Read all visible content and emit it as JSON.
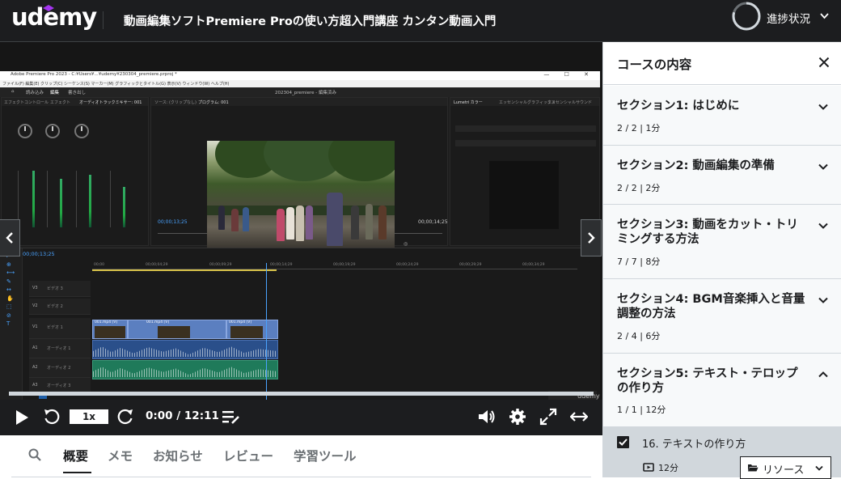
{
  "header": {
    "logo": "udemy",
    "course_title": "動画編集ソフトPremiere Proの使い方超入門講座 カンタン動画入門",
    "progress_label": "進捗状況"
  },
  "player": {
    "speed": "1x",
    "time": "0:00 / 12:11",
    "premiere": {
      "window_title": "Adobe Premiere Pro 2023 - C:¥Users¥...¥udemy¥230304_premiere.prproj *",
      "menu": "ファイル(F)  編集(E)  クリップ(C)  シーケンス(S)  マーカー(M)  グラフィックとタイトル(G)  表示(V)  ウィンドウ(W)  ヘルプ(H)",
      "workspace_tabs": [
        "読み込み",
        "編集",
        "書き出し"
      ],
      "project_name": "202304_premiere - 編集済み",
      "source_tabs": [
        "エフェクトコントロール",
        "エフェクト",
        "オーディオトラックミキサー: 001"
      ],
      "program_tabs": [
        "ソース: (クリップなし)",
        "プログラム: 001"
      ],
      "lumetri_tabs": [
        "Lumetri カラー",
        "エッセンシャルグラフィックス",
        "エッセンシャルサウンド"
      ],
      "timecode": "00;00;13;25",
      "duration": "00;00;14;25",
      "timeline_timecode": "00;00;13;25",
      "ruler": [
        "00;00",
        "00;00;04;29",
        "00;00;09;29",
        "00;00;14;29",
        "00;00;19;29",
        "00;00;24;29",
        "00;00;29;29",
        "00;00;34;29"
      ],
      "clip_label": "001.mp4 [V]",
      "track_labels": [
        "V3",
        "V2",
        "V1",
        "A1",
        "A2",
        "A3"
      ],
      "track_names": [
        "ビデオ 3",
        "ビデオ 2",
        "ビデオ 1",
        "オーディオ 1",
        "オーディオ 2",
        "オーディオ 3"
      ]
    }
  },
  "tabs": [
    {
      "label": "概要",
      "active": true
    },
    {
      "label": "メモ",
      "active": false
    },
    {
      "label": "お知らせ",
      "active": false
    },
    {
      "label": "レビュー",
      "active": false
    },
    {
      "label": "学習ツール",
      "active": false
    }
  ],
  "sidebar": {
    "title": "コースの内容",
    "sections": [
      {
        "title": "セクション1: はじめに",
        "meta": "2 / 2 | 1分",
        "expanded": false
      },
      {
        "title": "セクション2: 動画編集の準備",
        "meta": "2 / 2 | 2分",
        "expanded": false
      },
      {
        "title": "セクション3: 動画をカット・トリミングする方法",
        "meta": "7 / 7 | 8分",
        "expanded": false
      },
      {
        "title": "セクション4: BGM音楽挿入と音量調整の方法",
        "meta": "2 / 4 | 6分",
        "expanded": false
      },
      {
        "title": "セクション5: テキスト・テロップの作り方",
        "meta": "1 / 1 | 12分",
        "expanded": true
      }
    ],
    "lecture": {
      "title": "16. テキストの作り方",
      "duration": "12分",
      "completed": true,
      "resources_label": "リソース"
    }
  },
  "colors": {
    "header_bg": "#1c1d1f",
    "progress_ring": "#d1d7dc",
    "accent_purple": "#a435f0",
    "sidebar_active_bg": "#d1d7dc"
  }
}
